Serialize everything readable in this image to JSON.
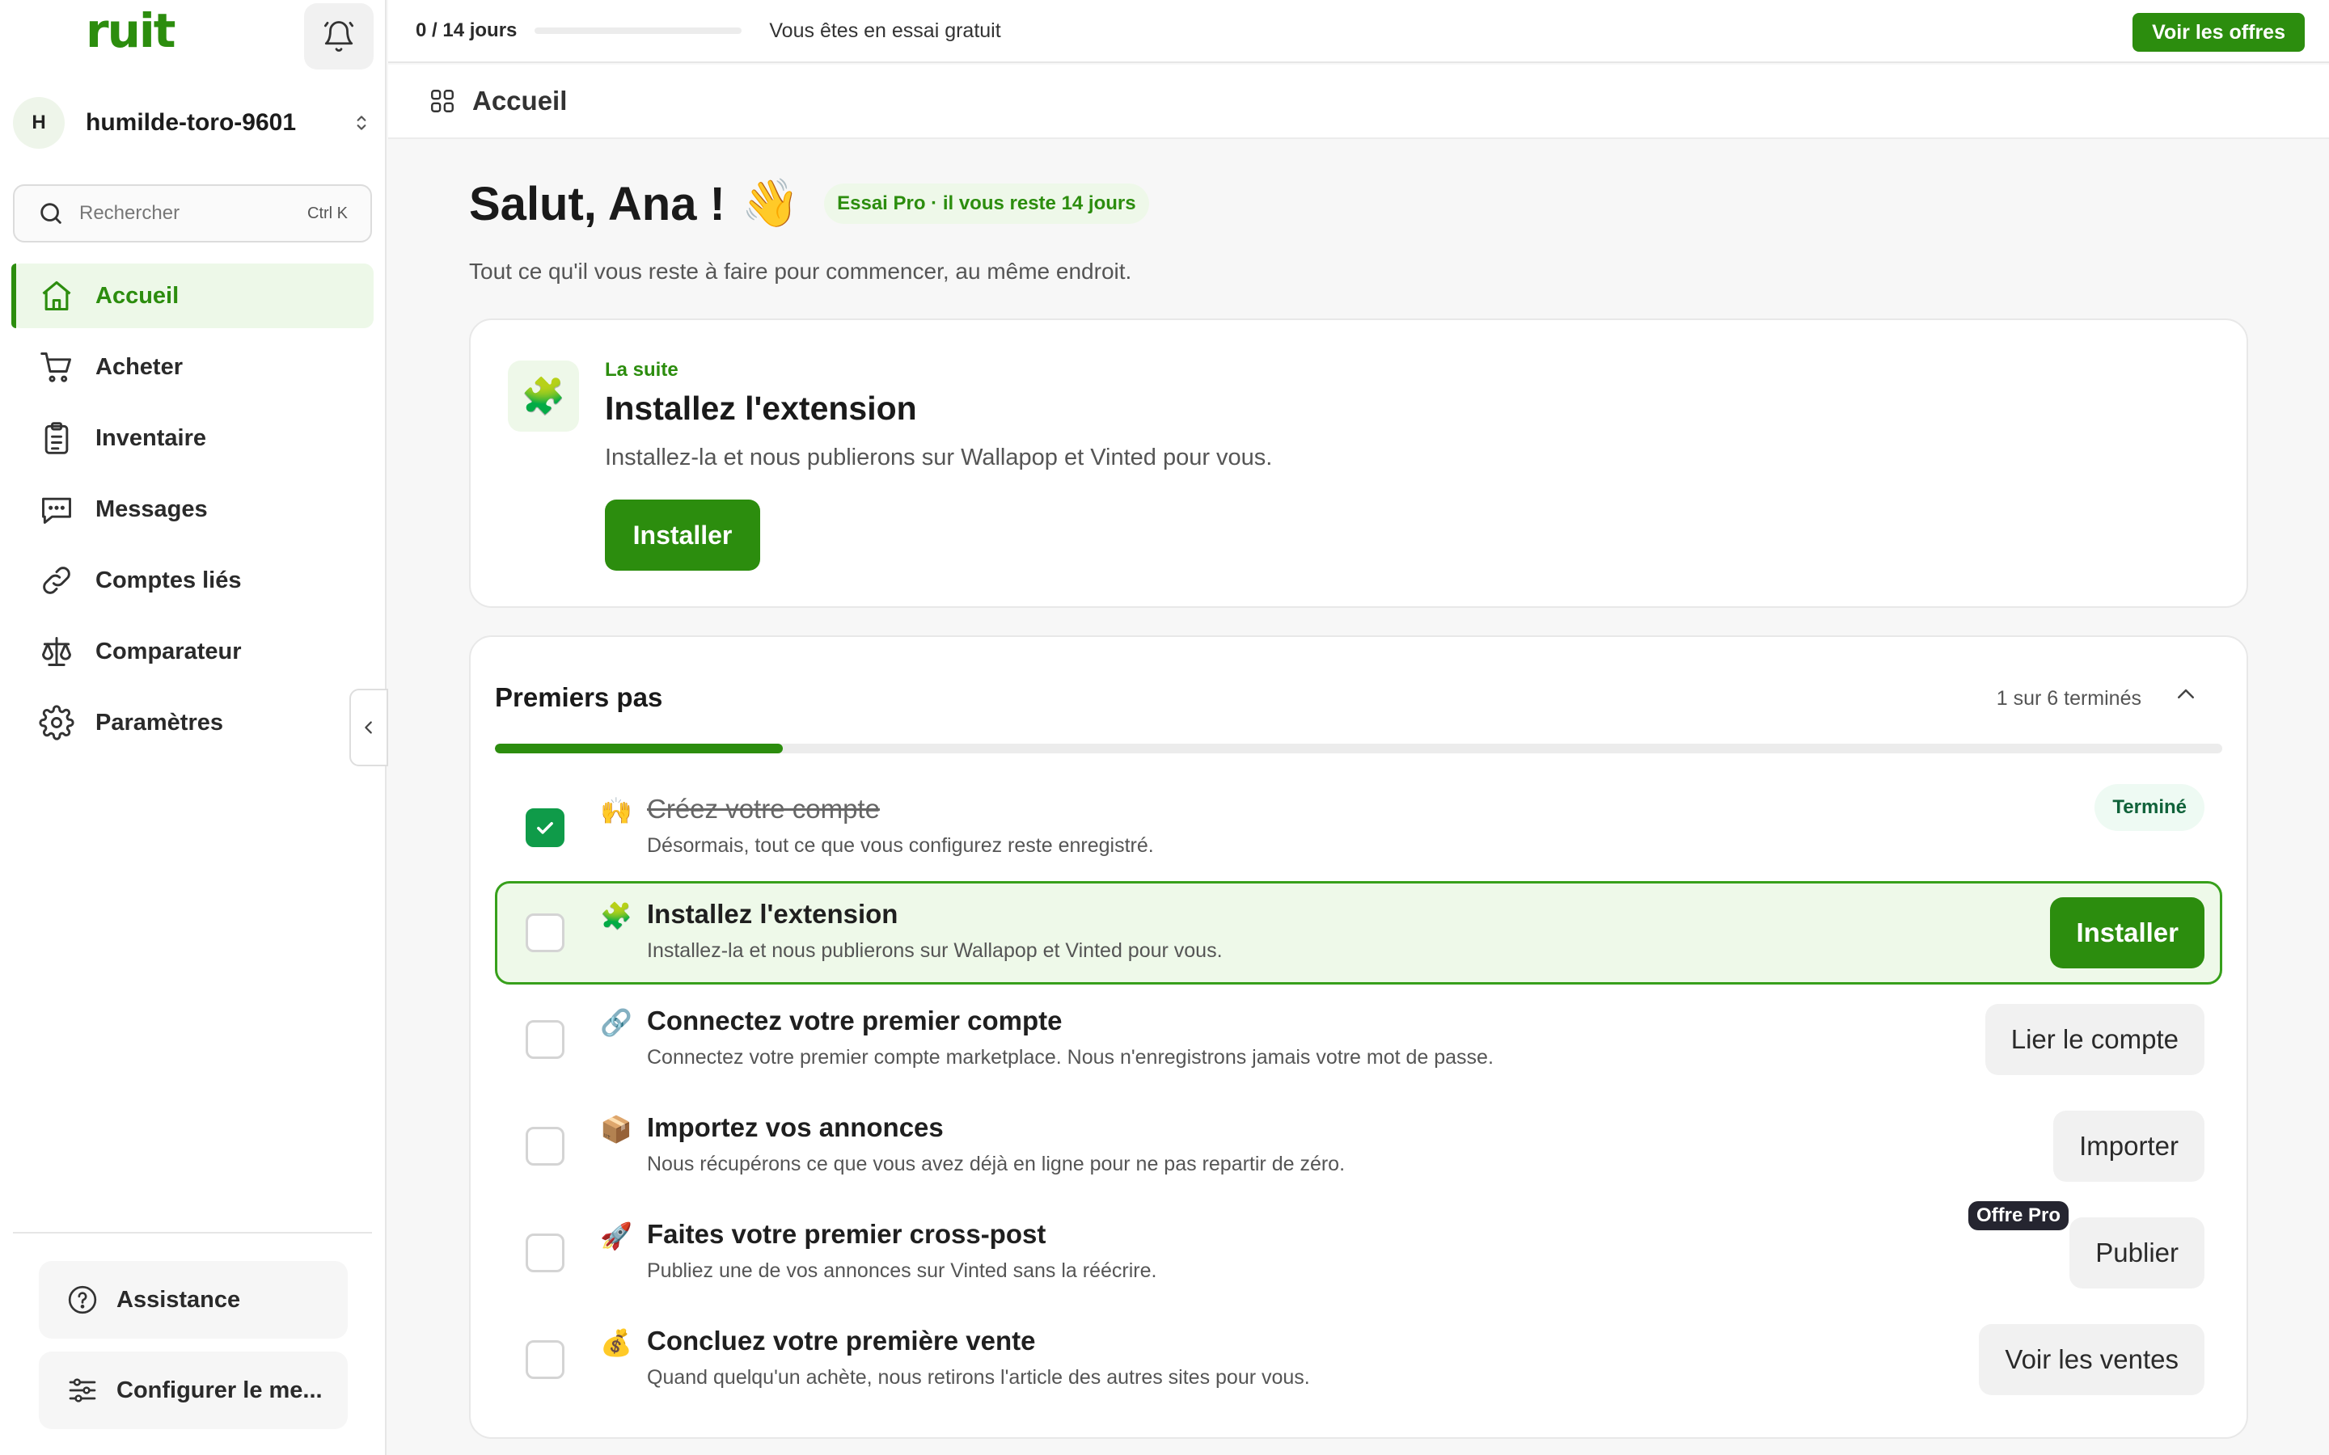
{
  "colors": {
    "brand": "#2c8d0e",
    "brand_soft": "#edf8e8",
    "success": "#0f9b49",
    "dark_badge": "#252530"
  },
  "sidebar": {
    "logo": "ruit",
    "account": {
      "initial": "H",
      "name": "humilde-toro-9601"
    },
    "search": {
      "placeholder": "Rechercher",
      "shortcut": "Ctrl K"
    },
    "items": [
      {
        "label": "Accueil",
        "icon": "home-icon",
        "active": true
      },
      {
        "label": "Acheter",
        "icon": "cart-icon"
      },
      {
        "label": "Inventaire",
        "icon": "clipboard-icon"
      },
      {
        "label": "Messages",
        "icon": "chat-icon"
      },
      {
        "label": "Comptes liés",
        "icon": "link-icon"
      },
      {
        "label": "Comparateur",
        "icon": "scale-icon"
      },
      {
        "label": "Paramètres",
        "icon": "gear-icon"
      }
    ],
    "bottom": {
      "support_label": "Assistance",
      "configure_label": "Configurer le me..."
    }
  },
  "topbar": {
    "trial_count": "0 / 14 jours",
    "trial_progress": 0,
    "trial_text": "Vous êtes en essai gratuit",
    "offers_label": "Voir les offres"
  },
  "crumb": {
    "title": "Accueil"
  },
  "hero": {
    "greeting": "Salut, Ana !",
    "wave": "👋",
    "pro_badge": "Essai Pro · il vous reste 14 jours",
    "subtitle": "Tout ce qu'il vous reste à faire pour commencer, au même endroit."
  },
  "next": {
    "emoji": "🧩",
    "eyebrow": "La suite",
    "title": "Installez l'extension",
    "description": "Installez-la et nous publierons sur Wallapop et Vinted pour vous.",
    "button": "Installer"
  },
  "steps": {
    "title": "Premiers pas",
    "count": "1 sur 6 terminés",
    "progress": 0.1667,
    "items": [
      {
        "emoji": "🙌",
        "title": "Créez votre compte",
        "desc": "Désormais, tout ce que vous configurez reste enregistré.",
        "done": true,
        "badge": "Terminé"
      },
      {
        "emoji": "🧩",
        "title": "Installez l'extension",
        "desc": "Installez-la et nous publierons sur Wallapop et Vinted pour vous.",
        "button": "Installer"
      },
      {
        "emoji": "🔗",
        "title": "Connectez votre premier compte",
        "desc": "Connectez votre premier compte marketplace. Nous n'enregistrons jamais votre mot de passe.",
        "button": "Lier le compte"
      },
      {
        "emoji": "📦",
        "title": "Importez vos annonces",
        "desc": "Nous récupérons ce que vous avez déjà en ligne pour ne pas repartir de zéro.",
        "button": "Importer"
      },
      {
        "emoji": "🚀",
        "title": "Faites votre premier cross-post",
        "desc": "Publiez une de vos annonces sur Vinted sans la réécrire.",
        "button": "Publier",
        "pro_label": "Offre Pro"
      },
      {
        "emoji": "💰",
        "title": "Concluez votre première vente",
        "desc": "Quand quelqu'un achète, nous retirons l'article des autres sites pour vous.",
        "button": "Voir les ventes"
      }
    ]
  }
}
